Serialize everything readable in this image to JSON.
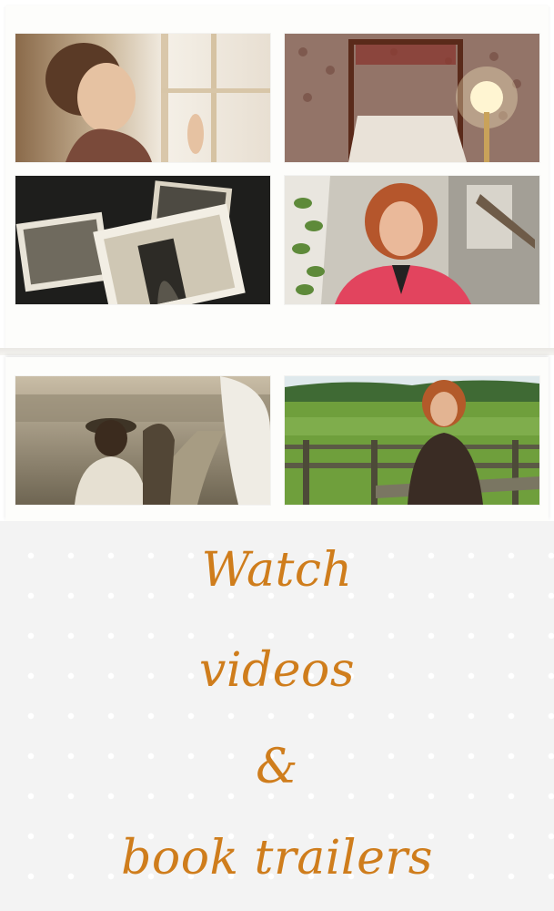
{
  "gallery": {
    "thumbnails": [
      {
        "icon": "woman-at-window-thumbnail"
      },
      {
        "icon": "canopy-bedroom-thumbnail"
      },
      {
        "icon": "vintage-photos-thumbnail"
      },
      {
        "icon": "author-speaking-thumbnail"
      },
      {
        "icon": "boy-with-horse-thumbnail"
      },
      {
        "icon": "author-by-fence-thumbnail"
      }
    ]
  },
  "caption": {
    "line1": "Watch",
    "line2": "videos",
    "line3": "&",
    "line4": "book trailers",
    "color": "#cf7d1c"
  },
  "colors": {
    "caption_background": "#f3f3f3",
    "panel_background": "#fdfdfb"
  }
}
